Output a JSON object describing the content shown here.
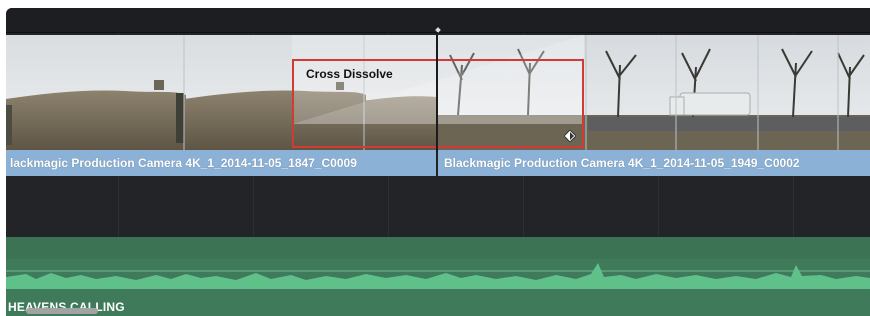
{
  "timeline": {
    "video_clips": [
      {
        "name": "lackmagic Production Camera 4K_1_2014-11-05_1847_C0009"
      },
      {
        "name": "Blackmagic Production Camera 4K_1_2014-11-05_1949_C0002"
      }
    ],
    "transition": {
      "label": "Cross Dissolve"
    },
    "audio_track": {
      "label": "HEAVENS CALLING"
    }
  },
  "colors": {
    "clip_label_bg": "#8cb1d6",
    "transition_border": "#d23a35",
    "audio_bg": "#3f7a5a",
    "waveform": "#5fc08a"
  },
  "icons": {
    "keyframe": "keyframe-diamond-icon"
  }
}
